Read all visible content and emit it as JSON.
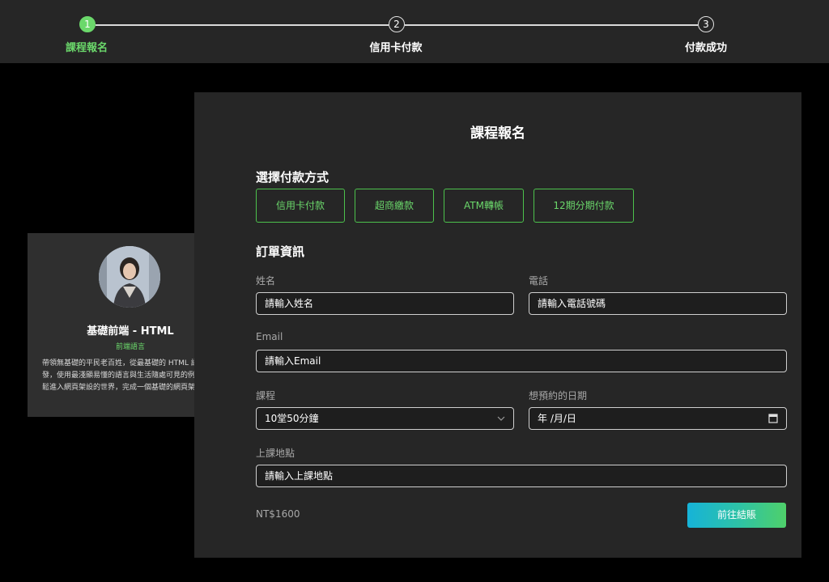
{
  "stepper": {
    "steps": [
      {
        "number": "1",
        "label": "課程報名",
        "state": "active"
      },
      {
        "number": "2",
        "label": "信用卡付款",
        "state": "idle"
      },
      {
        "number": "3",
        "label": "付款成功",
        "state": "idle"
      }
    ],
    "active_color": "#6bd86b"
  },
  "course": {
    "avatar_icon": "instructor-avatar",
    "title": "基礎前端 - HTML",
    "tag": "前端語言",
    "description": "帶領無基礎的平民老百姓，從最基礎的 HTML 語法出發，使用最淺顯易懂的語言與生活隨處可見的例子，輕鬆進入網頁架設的世界，完成一個基礎的網頁架設。"
  },
  "form": {
    "title": "課程報名",
    "payment_section_title": "選擇付款方式",
    "payment_methods": [
      "信用卡付款",
      "超商繳款",
      "ATM轉帳",
      "12期分期付款"
    ],
    "order_section_title": "訂單資訊",
    "name": {
      "label": "姓名",
      "placeholder": "請輸入姓名"
    },
    "phone": {
      "label": "電話",
      "placeholder": "請輸入電話號碼"
    },
    "email": {
      "label": "Email",
      "placeholder": "請輸入Email"
    },
    "course_select": {
      "label": "課程",
      "value": "10堂50分鐘",
      "icon": "chevron-down-icon"
    },
    "date": {
      "label": "想預約的日期",
      "value": "年 /月/日",
      "icon": "calendar-icon"
    },
    "location": {
      "label": "上課地點",
      "placeholder": "請輸入上課地點"
    },
    "price": "NT$1600",
    "checkout_label": "前往結賬",
    "accent_color": "#6bd86b"
  }
}
